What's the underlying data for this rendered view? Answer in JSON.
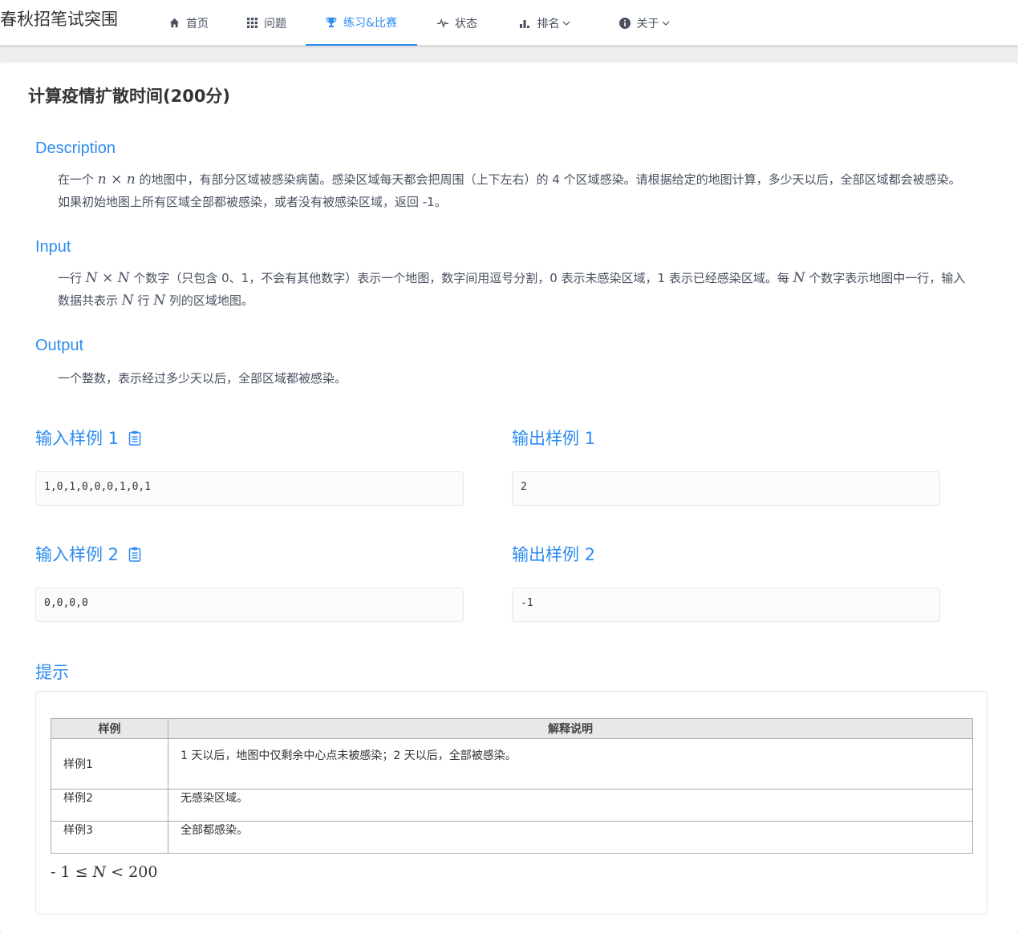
{
  "nav": {
    "brand": "春秋招笔试突围",
    "items": [
      {
        "label": "首页",
        "icon": "home-icon"
      },
      {
        "label": "问题",
        "icon": "grid-icon"
      },
      {
        "label": "练习&比赛",
        "icon": "trophy-icon"
      },
      {
        "label": "状态",
        "icon": "pulse-icon"
      },
      {
        "label": "排名",
        "icon": "bar-chart-icon"
      },
      {
        "label": "关于",
        "icon": "info-icon"
      }
    ],
    "active": "练习&比赛",
    "accent": "#2d8cf0"
  },
  "problem": {
    "title": "计算疫情扩散时间(200分)",
    "description": {
      "heading": "Description",
      "text_a": "在一个 ",
      "math_n1": "n",
      "times": " × ",
      "math_n2": "n",
      "text_b": " 的地图中，有部分区域被感染病菌。感染区域每天都会把周围（上下左右）的 4 个区域感染。请根据给定的地图计算，多少天以后，全部区域都会被感染。如果初始地图上所有区域全部都被感染，或者没有被感染区域，返回 -1。"
    },
    "input": {
      "heading": "Input",
      "text_a": "一行 ",
      "math_N1": "N",
      "times": " × ",
      "math_N2": "N",
      "text_b": " 个数字（只包含 0、1，不会有其他数字）表示一个地图，数字间用逗号分割，0 表示未感染区域，1 表示已经感染区域。每 ",
      "math_N3": "N",
      "text_c": " 个数字表示地图中一行，输入数据共表示 ",
      "math_N4": "N",
      "text_d": " 行 ",
      "math_N5": "N",
      "text_e": " 列的区域地图。"
    },
    "output": {
      "heading": "Output",
      "text": "一个整数，表示经过多少天以后，全部区域都被感染。"
    },
    "samples": [
      {
        "input_label": "输入样例 1",
        "input": "1,0,1,0,0,0,1,0,1",
        "output_label": "输出样例 1",
        "output": "2"
      },
      {
        "input_label": "输入样例 2",
        "input": "0,0,0,0",
        "output_label": "输出样例 2",
        "output": "-1"
      }
    ],
    "hint": {
      "heading": "提示",
      "columns": [
        "样例",
        "解释说明"
      ],
      "rows": [
        {
          "key": "样例1",
          "value": "1 天以后，地图中仅剩余中心点未被感染；2 天以后，全部被感染。"
        },
        {
          "key": "样例2",
          "value": "无感染区域。"
        },
        {
          "key": "样例3",
          "value": "全部都感染。"
        }
      ],
      "constraint_prefix": "- 1 ≤ ",
      "constraint_var": "N",
      "constraint_suffix": " < 200"
    }
  }
}
